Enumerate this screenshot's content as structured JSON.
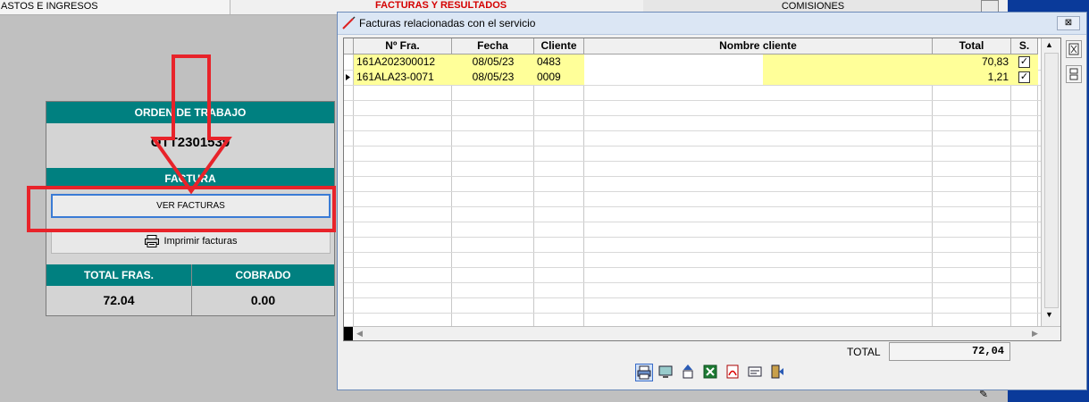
{
  "background": {
    "tab_gastos": "ASTOS E INGRESOS",
    "tab_facturas": "FACTURAS Y RESULTADOS",
    "tab_comisiones": "COMISIONES"
  },
  "order_panel": {
    "header": "ORDEN DE TRABAJO",
    "order_number": "OTT2301539",
    "facturas_header": "FACTURA",
    "ver_facturas_label": "VER FACTURAS",
    "imprimir_label": "Imprimir facturas",
    "total_fras_label": "TOTAL FRAS.",
    "total_fras_value": "72.04",
    "cobrado_label": "COBRADO",
    "cobrado_value": "0.00"
  },
  "dialog": {
    "title": "Facturas relacionadas con el servicio",
    "close_label": "⊠",
    "columns": [
      "Nº Fra.",
      "Fecha",
      "Cliente",
      "Nombre cliente",
      "Total",
      "S."
    ],
    "rows": [
      {
        "numero": "161A202300012",
        "fecha": "08/05/23",
        "cliente": "0483",
        "nombre": "",
        "total": "70,83",
        "s": true
      },
      {
        "numero": "161ALA23-0071",
        "fecha": "08/05/23",
        "cliente": "0009",
        "nombre": "",
        "total": "1,21",
        "s": true
      }
    ],
    "total_label": "TOTAL",
    "total_value": "72,04"
  },
  "colors": {
    "teal": "#008080",
    "row_yellow": "#ffff99",
    "annotation_red": "#e8232a",
    "tab_red": "#d40000"
  }
}
